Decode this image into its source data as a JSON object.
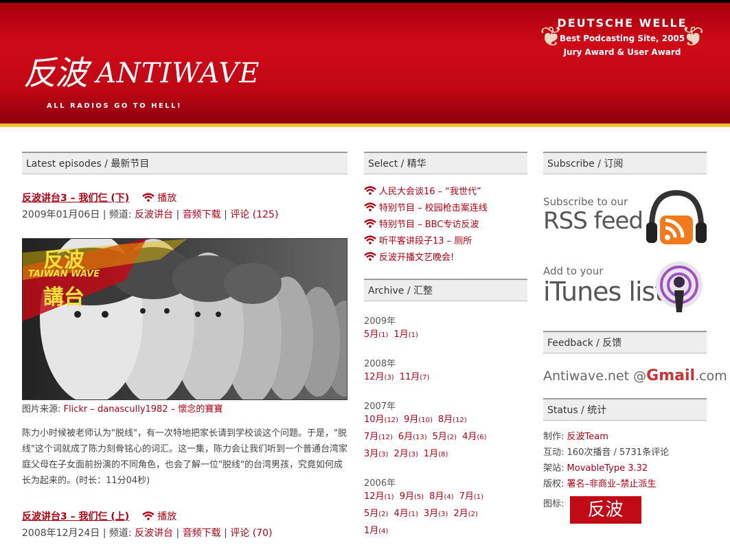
{
  "header": {
    "logo_cn": "反波",
    "logo_en": "ANTIWAVE",
    "tagline": "ALL RADIOS GO TO HELL!",
    "award": {
      "line1": "DEUTSCHE WELLE",
      "line2": "Best Podcasting Site, 2005",
      "line3": "Jury Award & User Award"
    }
  },
  "latest": {
    "heading": "Latest episodes / 最新节目",
    "play_label": "播放",
    "episodes": [
      {
        "title": "反波讲台3 – 我们仨 (下)",
        "date": "2009年01月06日",
        "channel_label": "| 频道:",
        "channel": "反波讲台",
        "download": "音频下载",
        "comments": "评论 (125)"
      },
      {
        "title": "反波讲台3 – 我们仨 (上)",
        "date": "2008年12月24日",
        "channel_label": "| 频道:",
        "channel": "反波讲台",
        "download": "音频下载",
        "comments": "评论 (70)"
      }
    ],
    "photo_overlay": {
      "cn1": "反波",
      "en": "TAIWAN WAVE",
      "cn2": "講台"
    },
    "credit_label": "图片来源:",
    "credit_link": "Flickr – danascully1982 – 懷念的寶寶",
    "description": "陈力小时候被老师认为\"脱线\"，有一次特地把家长请到学校谈这个问题。于是，\"脱线\"这个词就成了陈力刻骨铭心的词汇。这一集，陈力会让我们听到一个普通台湾家庭父母在子女面前扮演的不同角色，也会了解一位\"脱线\"的台湾男孩，究竟如何成长为起来的。(时长：11分04秒)"
  },
  "select": {
    "heading": "Select / 精华",
    "items": [
      "人民大会谈16 – “我世代”",
      "特别节目 – 校园枪击案连线",
      "特别节目 – BBC专访反波",
      "听平客讲段子13 – 厕所",
      "反波开播文艺晚会!"
    ]
  },
  "archive": {
    "heading": "Archive / 汇整",
    "years": [
      {
        "year": "2009年",
        "rows": [
          [
            [
              "5月",
              "(1)"
            ],
            [
              "1月",
              "(1)"
            ]
          ]
        ]
      },
      {
        "year": "2008年",
        "rows": [
          [
            [
              "12月",
              "(3)"
            ],
            [
              "11月",
              "(7)"
            ]
          ]
        ]
      },
      {
        "year": "2007年",
        "rows": [
          [
            [
              "10月",
              "(12)"
            ],
            [
              "9月",
              "(10)"
            ],
            [
              "8月",
              "(12)"
            ]
          ],
          [
            [
              "7月",
              "(12)"
            ],
            [
              "6月",
              "(13)"
            ],
            [
              "5月",
              "(2)"
            ],
            [
              "4月",
              "(6)"
            ]
          ],
          [
            [
              "3月",
              "(3)"
            ],
            [
              "2月",
              "(3)"
            ],
            [
              "1月",
              "(8)"
            ]
          ]
        ]
      },
      {
        "year": "2006年",
        "rows": [
          [
            [
              "12月",
              "(1)"
            ],
            [
              "9月",
              "(5)"
            ],
            [
              "8月",
              "(4)"
            ],
            [
              "7月",
              "(1)"
            ]
          ],
          [
            [
              "5月",
              "(2)"
            ],
            [
              "4月",
              "(1)"
            ],
            [
              "3月",
              "(3)"
            ],
            [
              "2月",
              "(2)"
            ]
          ],
          [
            [
              "1月",
              "(4)"
            ]
          ]
        ]
      }
    ]
  },
  "subscribe": {
    "heading": "Subscribe / 订阅",
    "rss_small": "Subscribe to our",
    "rss_big": "RSS feed",
    "itunes_small": "Add to your",
    "itunes_big": "iTunes list"
  },
  "feedback": {
    "heading": "Feedback / 反馈",
    "prefix": "Antiwave.net @",
    "gmail": "Gmail",
    "suffix": ".com"
  },
  "status": {
    "heading": "Status / 统计",
    "rows": [
      {
        "label": "制作:",
        "value": "反波Team",
        "link": true
      },
      {
        "label": "互动:",
        "value": "160次播音 / 5731条评论",
        "link": false
      },
      {
        "label": "架站:",
        "value": "MovableType 3.32",
        "link": true
      },
      {
        "label": "版权:",
        "value": "署名–非商业–禁止派生",
        "link": true
      },
      {
        "label": "图标:",
        "value": "",
        "link": false
      }
    ],
    "icon_text": "反波"
  },
  "colors": {
    "brand_red": "#c00a16",
    "link_red": "#b00014",
    "gold": "#f2c230"
  }
}
